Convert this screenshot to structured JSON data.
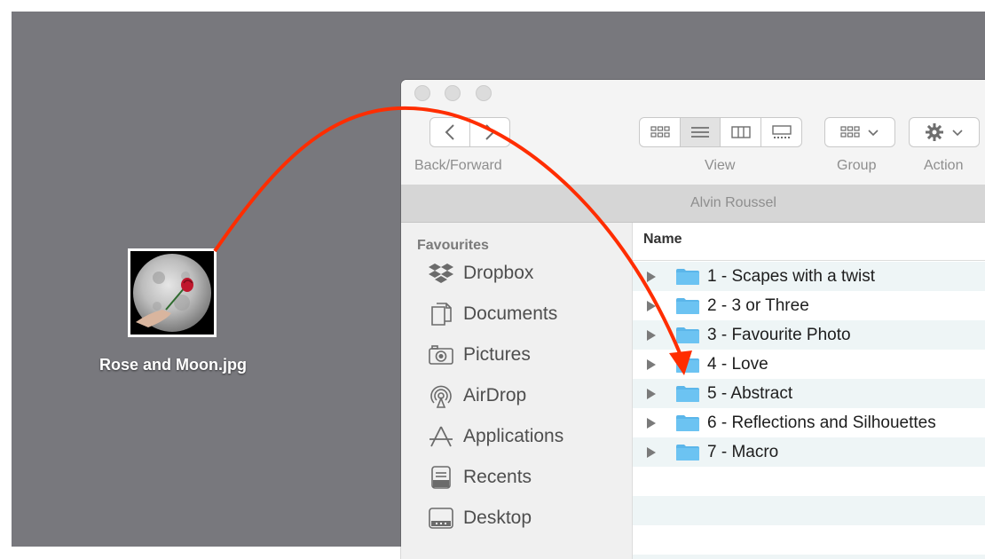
{
  "desktop": {
    "file": {
      "name": "Rose and Moon.jpg",
      "icon": "image-thumbnail"
    }
  },
  "finder": {
    "window_title": "Alvin Roussel",
    "toolbar": {
      "back_forward_label": "Back/Forward",
      "view_label": "View",
      "group_label": "Group",
      "action_label": "Action",
      "view_modes": [
        "icon-view",
        "list-view",
        "column-view",
        "gallery-view"
      ],
      "selected_view": "list-view"
    },
    "sidebar": {
      "heading": "Favourites",
      "items": [
        {
          "label": "Dropbox",
          "icon": "dropbox-icon"
        },
        {
          "label": "Documents",
          "icon": "documents-icon"
        },
        {
          "label": "Pictures",
          "icon": "camera-icon"
        },
        {
          "label": "AirDrop",
          "icon": "airdrop-icon"
        },
        {
          "label": "Applications",
          "icon": "applications-icon"
        },
        {
          "label": "Recents",
          "icon": "recents-icon"
        },
        {
          "label": "Desktop",
          "icon": "desktop-icon"
        }
      ]
    },
    "list": {
      "column_name": "Name",
      "rows": [
        {
          "label": "1 - Scapes with a twist"
        },
        {
          "label": "2 - 3 or Three"
        },
        {
          "label": "3 - Favourite Photo"
        },
        {
          "label": "4 - Love"
        },
        {
          "label": "5 - Abstract"
        },
        {
          "label": "6 - Reflections and Silhouettes"
        },
        {
          "label": "7 - Macro"
        }
      ]
    }
  },
  "colors": {
    "desktop": "#78787d",
    "folder": "#5bb6ea",
    "arrow": "#ff2d00",
    "row_alt": "#eef5f6"
  }
}
